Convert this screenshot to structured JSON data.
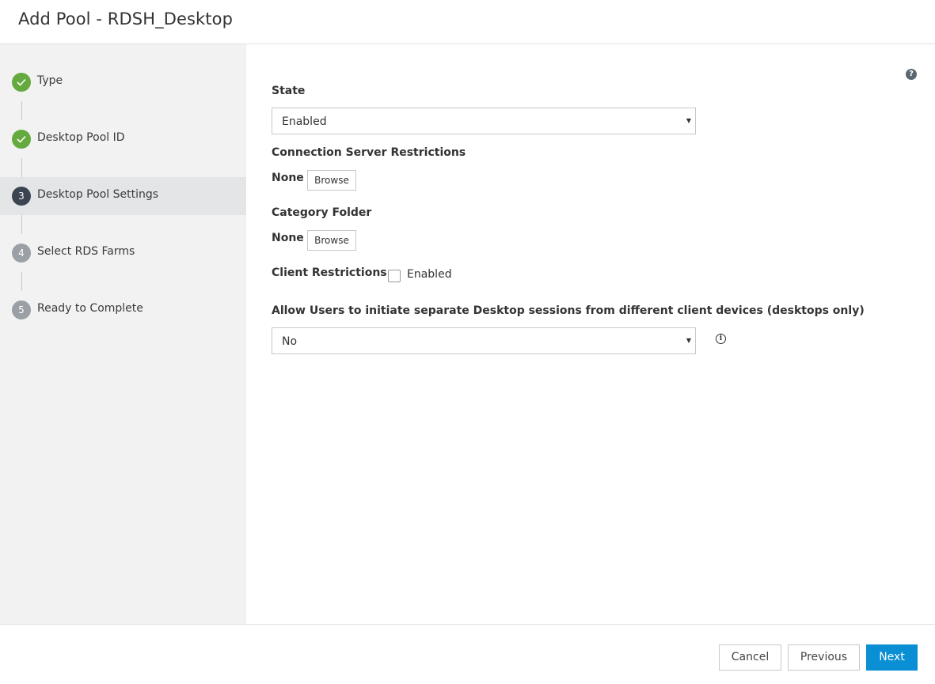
{
  "header": {
    "title": "Add Pool - RDSH_Desktop"
  },
  "steps": [
    {
      "number": "1",
      "label": "Type",
      "status": "done"
    },
    {
      "number": "2",
      "label": "Desktop Pool ID",
      "status": "done"
    },
    {
      "number": "3",
      "label": "Desktop Pool Settings",
      "status": "current"
    },
    {
      "number": "4",
      "label": "Select RDS Farms",
      "status": "todo"
    },
    {
      "number": "5",
      "label": "Ready to Complete",
      "status": "todo"
    }
  ],
  "form": {
    "help_glyph": "?",
    "state": {
      "label": "State",
      "value": "Enabled"
    },
    "connection_server": {
      "label": "Connection Server Restrictions",
      "value": "None",
      "button": "Browse"
    },
    "category_folder": {
      "label": "Category Folder",
      "value": "None",
      "button": "Browse"
    },
    "client_restrictions": {
      "label": "Client Restrictions",
      "checkbox_label": "Enabled",
      "checked": false
    },
    "separate_sessions": {
      "label": "Allow Users to initiate separate Desktop sessions from different client devices (desktops only)",
      "value": "No"
    },
    "info_glyph": "i"
  },
  "footer": {
    "cancel": "Cancel",
    "previous": "Previous",
    "next": "Next"
  },
  "colors": {
    "accent": "#0a8fd4",
    "done": "#65aa3e",
    "current": "#3a4551",
    "todo": "#9aa0a6"
  }
}
